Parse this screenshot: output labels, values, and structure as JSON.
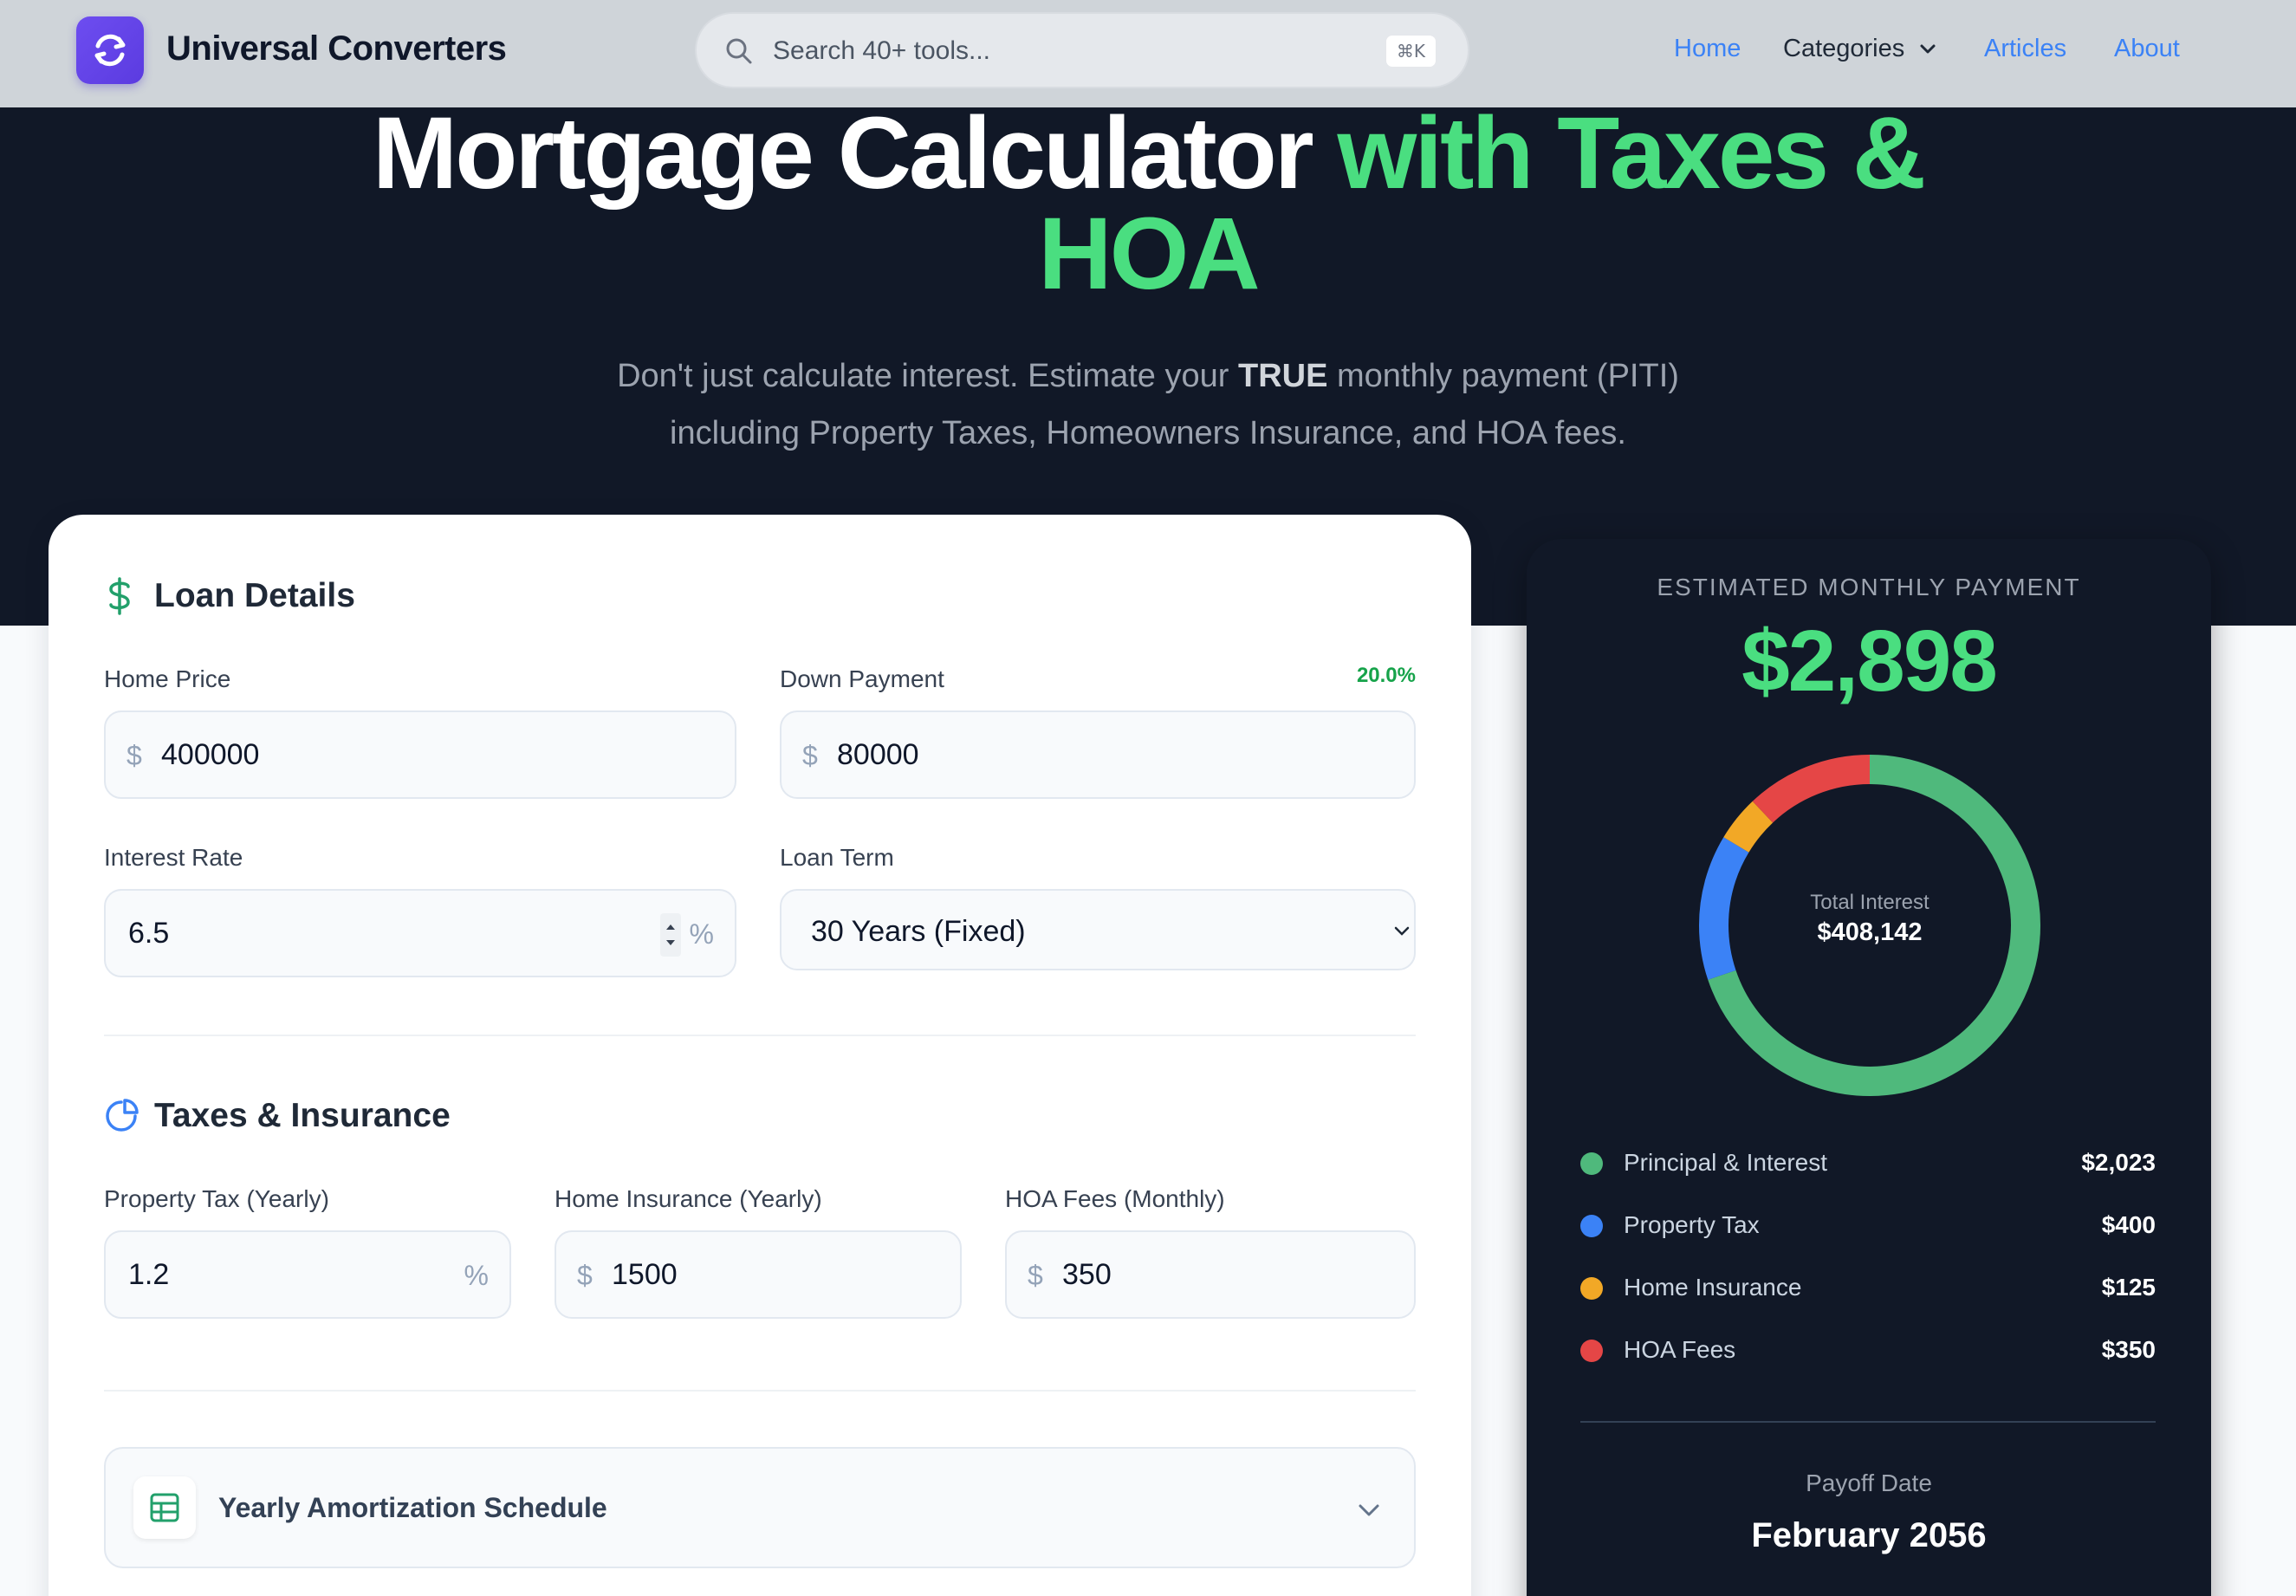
{
  "header": {
    "brand": "Universal Converters",
    "search_placeholder": "Search 40+ tools...",
    "search_shortcut": "⌘K",
    "nav": {
      "home": "Home",
      "categories": "Categories",
      "articles": "Articles",
      "about": "About"
    }
  },
  "hero": {
    "title_white": "Mortgage Calculator",
    "title_green_1": "with Taxes &",
    "title_green_2": "HOA",
    "subtitle_line1_pre": "Don't just calculate interest. Estimate your",
    "subtitle_line1_bold": "TRUE",
    "subtitle_line1_post": "monthly payment (PITI)",
    "subtitle_line2": "including Property Taxes, Homeowners Insurance, and HOA fees."
  },
  "loan": {
    "title": "Loan Details",
    "home_price_label": "Home Price",
    "home_price_value": "400000",
    "down_payment_label": "Down Payment",
    "down_payment_value": "80000",
    "down_payment_pct": "20.0%",
    "interest_label": "Interest Rate",
    "interest_value": "6.5",
    "term_label": "Loan Term",
    "term_value": "30 Years (Fixed)",
    "currency_symbol": "$",
    "percent_symbol": "%"
  },
  "taxes": {
    "title": "Taxes & Insurance",
    "property_tax_label": "Property Tax (Yearly)",
    "property_tax_value": "1.2",
    "insurance_label": "Home Insurance (Yearly)",
    "insurance_value": "1500",
    "hoa_label": "HOA Fees (Monthly)",
    "hoa_value": "350"
  },
  "amortization": {
    "label": "Yearly Amortization Schedule"
  },
  "summary": {
    "eyebrow": "ESTIMATED MONTHLY PAYMENT",
    "amount": "$2,898",
    "center_label": "Total Interest",
    "center_value": "$408,142",
    "payoff_label": "Payoff Date",
    "payoff_value": "February 2056",
    "breakdown": [
      {
        "name": "Principal & Interest",
        "amount": "$2,023",
        "value": 2023,
        "color": "#4fb97c"
      },
      {
        "name": "Property Tax",
        "amount": "$400",
        "value": 400,
        "color": "#3b82f6"
      },
      {
        "name": "Home Insurance",
        "amount": "$125",
        "value": 125,
        "color": "#f2a826"
      },
      {
        "name": "HOA Fees",
        "amount": "$350",
        "value": 350,
        "color": "#e54646"
      }
    ]
  }
}
